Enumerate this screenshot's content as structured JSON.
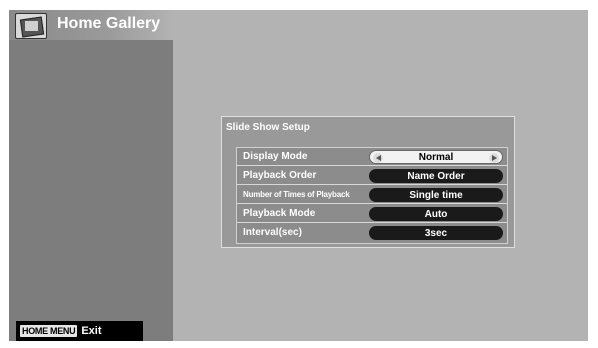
{
  "app": {
    "title": "Home Gallery",
    "icon": "photo-frame-icon"
  },
  "footer": {
    "key_label": "HOME MENU",
    "action_label": "Exit"
  },
  "dialog": {
    "title": "Slide Show Setup",
    "rows": [
      {
        "label": "Display Mode",
        "value": "Normal",
        "selected": true
      },
      {
        "label": "Playback Order",
        "value": "Name Order",
        "selected": false
      },
      {
        "label": "Number of Times of Playback",
        "value": "Single time",
        "selected": false
      },
      {
        "label": "Playback Mode",
        "value": "Auto",
        "selected": false
      },
      {
        "label": "Interval(sec)",
        "value": "3sec",
        "selected": false
      }
    ]
  },
  "colors": {
    "screen_bg": "#b3b3b3",
    "sidebar_bg": "#7d7d7d",
    "pill_bg": "#1a1a1a",
    "selected_pill_bg": "#f2f2f2"
  }
}
